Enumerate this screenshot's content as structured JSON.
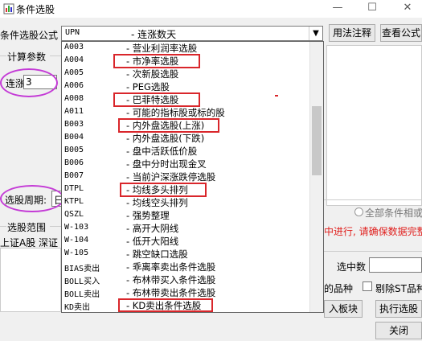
{
  "window": {
    "title": "条件选股",
    "minimize": "—",
    "maximize": "☐",
    "close": "✕"
  },
  "formula_label": "条件选股公式",
  "combo": {
    "code": "UPN",
    "name": "- 连涨数天"
  },
  "usage_button": "用法注释",
  "view_button": "查看公式",
  "calc_params_label": "计算参数",
  "param": {
    "label": "连涨",
    "value": "3"
  },
  "period": {
    "label": "选股周期:",
    "value": "日"
  },
  "scope_label": "选股范围",
  "scope_items": "上证A股  深证",
  "all_conditions_label": "全部条件相或",
  "warning_text": "中进行, 请确保数据完整",
  "selected_count_label": "选中数",
  "varieties_label": "的品种",
  "exclude_st_label": "剔除ST品种",
  "add_to_block_button": "入板块",
  "execute_button": "执行选股",
  "close_button": "关闭",
  "list_items": [
    {
      "code": "A003",
      "name": "- 营业利润率选股"
    },
    {
      "code": "A004",
      "name": "- 市净率选股"
    },
    {
      "code": "A005",
      "name": "- 次新股选股"
    },
    {
      "code": "A006",
      "name": "- PEG选股"
    },
    {
      "code": "A008",
      "name": "- 巴菲特选股"
    },
    {
      "code": "A011",
      "name": "- 可能的指标股或标的股"
    },
    {
      "code": "B003",
      "name": "- 内外盘选股(上涨)"
    },
    {
      "code": "B004",
      "name": "- 内外盘选股(下跌)"
    },
    {
      "code": "B005",
      "name": "- 盘中活跃低价股"
    },
    {
      "code": "B006",
      "name": "- 盘中分时出现金叉"
    },
    {
      "code": "B007",
      "name": "- 当前沪深涨跌停选股"
    },
    {
      "code": "DTPL",
      "name": "- 均线多头排列"
    },
    {
      "code": "KTPL",
      "name": "- 均线空头排列"
    },
    {
      "code": "QSZL",
      "name": "- 强势整理"
    },
    {
      "code": "W-103",
      "name": "- 高开大阴线"
    },
    {
      "code": "W-104",
      "name": "- 低开大阳线"
    },
    {
      "code": "W-105",
      "name": "- 跳空缺口选股"
    },
    {
      "code": "BIAS卖出",
      "name": "- 乖离率卖出条件选股"
    },
    {
      "code": "BOLL买入",
      "name": "- 布林带买入条件选股"
    },
    {
      "code": "BOLL卖出",
      "name": "- 布林带卖出条件选股"
    },
    {
      "code": "KD卖出",
      "name": "- KD卖出条件选股"
    }
  ]
}
